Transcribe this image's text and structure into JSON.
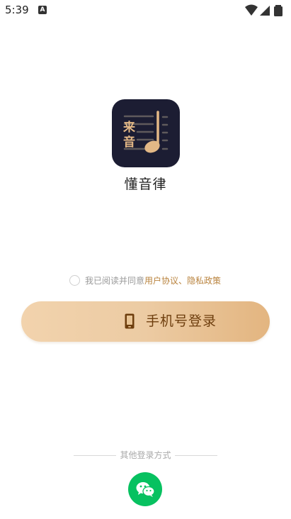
{
  "status_bar": {
    "time": "5:39",
    "notification_icon": "a-icon",
    "icons": [
      "wifi-icon",
      "signal-icon",
      "battery-icon"
    ]
  },
  "app": {
    "logo_chars": [
      "来",
      "音"
    ],
    "name": "懂音律"
  },
  "agreement": {
    "checked": false,
    "prefix": "我已阅读并同意",
    "user_agreement": "用户协议",
    "separator": "、",
    "privacy_policy": "隐私政策"
  },
  "login": {
    "phone_label": "手机号登录",
    "icon": "phone-icon"
  },
  "other_login": {
    "title": "其他登录方式",
    "wechat_icon": "wechat-icon"
  },
  "colors": {
    "accent": "#b9833e",
    "button_start": "#f2d3ad",
    "button_end": "#e3b580",
    "button_text": "#6e3e0e",
    "logo_bg": "#1c1d33",
    "logo_fg": "#e3b886",
    "wechat": "#07c160"
  }
}
